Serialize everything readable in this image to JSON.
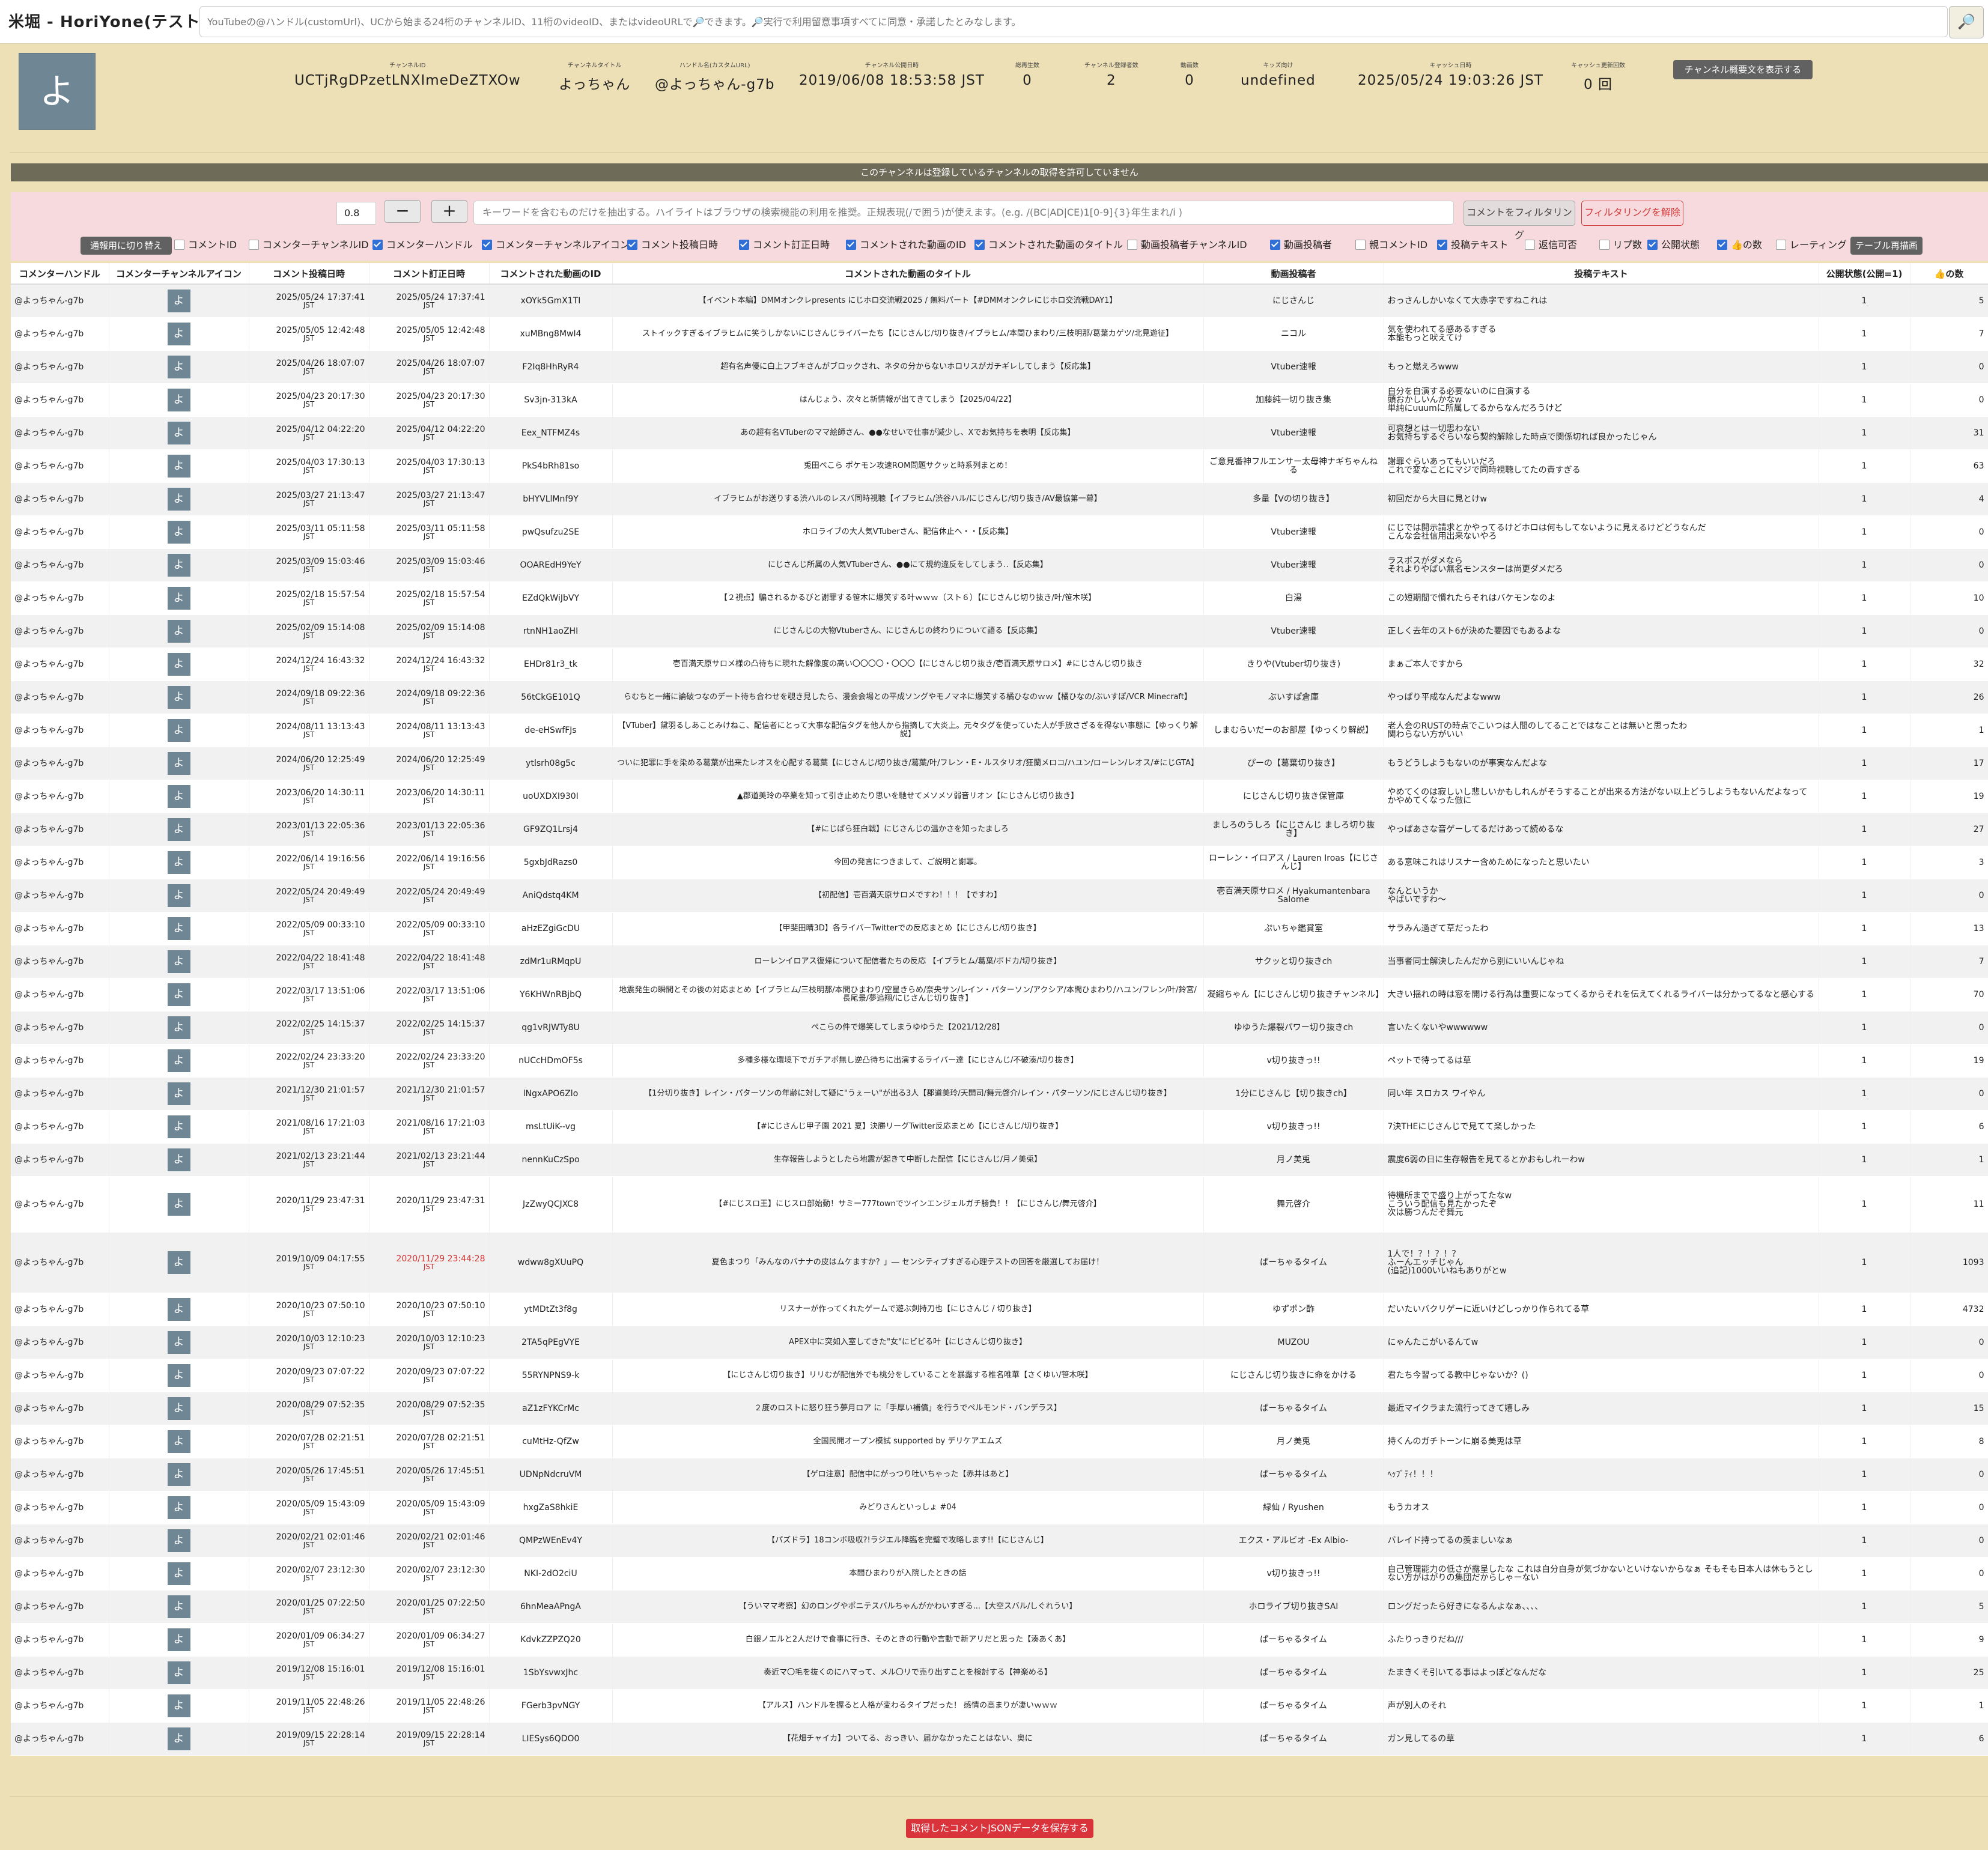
{
  "app_title": "米堀 - HoriYone(テスト中)",
  "search": {
    "placeholder": "YouTubeの@ハンドル(customUrl)、UCから始まる24桁のチャンネルID、11桁のvideoID、またはvideoURLで🔎できます。🔎実行で利用留意事項すべてに同意・承諾したとみなします。",
    "button_icon": "🔎"
  },
  "channel": {
    "avatar_char": "よ",
    "fields": [
      {
        "label": "チャンネルID",
        "value": "UCTjRgDPzetLNXImeDeZTXOw"
      },
      {
        "label": "チャンネルタイトル",
        "value": "よっちゃん"
      },
      {
        "label": "ハンドル名(カスタムURL)",
        "value": "@よっちゃん-g7b"
      },
      {
        "label": "チャンネル公開日時",
        "value": "2019/06/08 18:53:58 JST"
      },
      {
        "label": "総再生数",
        "value": "0"
      },
      {
        "label": "チャンネル登録者数",
        "value": "2"
      },
      {
        "label": "動画数",
        "value": "0"
      },
      {
        "label": "キッズ向け",
        "value": "undefined"
      },
      {
        "label": "キャッシュ日時",
        "value": "2025/05/24 19:03:26 JST"
      },
      {
        "label": "キャッシュ更新回数",
        "value": "0 回"
      }
    ],
    "show_desc_label": "チャンネル概要文を表示する"
  },
  "notice": "このチャンネルは登録しているチャンネルの取得を許可していません",
  "filter": {
    "threshold": "0.8",
    "minus": "−",
    "plus": "+",
    "keyword_placeholder": "キーワードを含むものだけを抽出する。ハイライトはブラウザの検索機能の利用を推奨。正規表現(/で囲う)が使えます。(e.g. /(BC|AD|CE)1[0-9]{3}年生まれ/i )",
    "filter_button": "コメントをフィルタリング",
    "clear_button": "フィルタリングを解除",
    "switch_button": "通報用に切り替え",
    "redraw_button": "テーブル再描画",
    "checkboxes": [
      {
        "label": "コメントID",
        "checked": false
      },
      {
        "label": "コメンターチャンネルID",
        "checked": false
      },
      {
        "label": "コメンターハンドル",
        "checked": true
      },
      {
        "label": "コメンターチャンネルアイコン",
        "checked": true
      },
      {
        "label": "コメント投稿日時",
        "checked": true
      },
      {
        "label": "コメント訂正日時",
        "checked": true
      },
      {
        "label": "コメントされた動画のID",
        "checked": true
      },
      {
        "label": "コメントされた動画のタイトル",
        "checked": true
      },
      {
        "label": "動画投稿者チャンネルID",
        "checked": false
      },
      {
        "label": "動画投稿者",
        "checked": true
      },
      {
        "label": "親コメントID",
        "checked": false
      },
      {
        "label": "投稿テキスト",
        "checked": true
      },
      {
        "label": "返信可否",
        "checked": false
      },
      {
        "label": "リプ数",
        "checked": false
      },
      {
        "label": "公開状態",
        "checked": true
      },
      {
        "label": "👍の数",
        "checked": true
      },
      {
        "label": "レーティング",
        "checked": false
      }
    ]
  },
  "table": {
    "headers": [
      "コメンターハンドル",
      "コメンターチャンネルアイコン",
      "コメント投稿日時",
      "コメント訂正日時",
      "コメントされた動画のID",
      "コメントされた動画のタイトル",
      "動画投稿者",
      "投稿テキスト",
      "公開状態(公開=1)",
      "👍の数"
    ],
    "rows": [
      [
        "@よっちゃん-g7b",
        "よ",
        "2025/05/24 17:37:41",
        "2025/05/24 17:37:41",
        "xOYk5GmX1TI",
        "【イベント本編】DMMオンクレpresents にじホロ交流戦2025 / 無料パート【#DMMオンクレにじホロ交流戦DAY1】",
        "にじさんじ",
        "おっさんしかいなくて大赤字ですねこれは",
        "1",
        "5"
      ],
      [
        "@よっちゃん-g7b",
        "よ",
        "2025/05/05 12:42:48",
        "2025/05/05 12:42:48",
        "xuMBng8MwI4",
        "ストイックすぎるイブラヒムに笑うしかないにじさんじライバーたち【にじさんじ/切り抜き/イブラヒム/本間ひまわり/三枝明那/葛葉カゲツ/北見遊征】",
        "ニコル",
        "気を使われてる感あるすぎる\n本能もっと吠えてけ",
        "1",
        "7"
      ],
      [
        "@よっちゃん-g7b",
        "よ",
        "2025/04/26 18:07:07",
        "2025/04/26 18:07:07",
        "F2Iq8HhRyR4",
        "超有名声優に白上フブキさんがブロックされ、ネタの分からないホロリスがガチギレしてしまう【反応集】",
        "Vtuber速報",
        "もっと燃えろwww",
        "1",
        "0"
      ],
      [
        "@よっちゃん-g7b",
        "よ",
        "2025/04/23 20:17:30",
        "2025/04/23 20:17:30",
        "Sv3jn-313kA",
        "はんじょう、次々と新情報が出てきてしまう【2025/04/22】",
        "加藤純一切り抜き集",
        "自分を自演する必要ないのに自演する\n頭おかしいんかなw\n単純にuuumに所属してるからなんだろうけど",
        "1",
        "0"
      ],
      [
        "@よっちゃん-g7b",
        "よ",
        "2025/04/12 04:22:20",
        "2025/04/12 04:22:20",
        "Eex_NTFMZ4s",
        "あの超有名VTuberのママ絵師さん、●●なせいで仕事が減少し、Xでお気持ちを表明【反応集】",
        "Vtuber速報",
        "可哀想とは一切思わない\nお気持ちするぐらいなら契約解除した時点で関係切れば良かったじゃん",
        "1",
        "31"
      ],
      [
        "@よっちゃん-g7b",
        "よ",
        "2025/04/03 17:30:13",
        "2025/04/03 17:30:13",
        "PkS4bRh81so",
        "兎田ぺこら ポケモン攻速ROM問題サクッと時系列まとめ！",
        "ご意見番神フルエンサー太母神ナギちゃんねる",
        "謝罪ぐらいあってもいいだろ\nこれで変なことにマジで同時視聴してたの責すぎる",
        "1",
        "63"
      ],
      [
        "@よっちゃん-g7b",
        "よ",
        "2025/03/27 21:13:47",
        "2025/03/27 21:13:47",
        "bHYVLlMnf9Y",
        "イブラヒムがお送りする渋ハルのレスバ同時視聴【イブラヒム/渋谷ハル/にじさんじ/切り抜き/AV最協第一幕】",
        "多量【Vの切り抜き】",
        "初回だから大目に見とけw",
        "1",
        "4"
      ],
      [
        "@よっちゃん-g7b",
        "よ",
        "2025/03/11 05:11:58",
        "2025/03/11 05:11:58",
        "pwQsufzu2SE",
        "ホロライブの大人気VTuberさん、配信休止へ・・【反応集】",
        "Vtuber速報",
        "にじでは開示請求とかやってるけどホロは何もしてないように見えるけどどうなんだ\nこんな会社信用出来ないやろ",
        "1",
        "0"
      ],
      [
        "@よっちゃん-g7b",
        "よ",
        "2025/03/09 15:03:46",
        "2025/03/09 15:03:46",
        "OOAREdH9YeY",
        "にじさんじ所属の人気VTuberさん、●●にて規約違反をしてしまう‥【反応集】",
        "Vtuber速報",
        "ラスボスがダメなら\nそれよりやばい無名モンスターは尚更ダメだろ",
        "1",
        "0"
      ],
      [
        "@よっちゃん-g7b",
        "よ",
        "2025/02/18 15:57:54",
        "2025/02/18 15:57:54",
        "EZdQkWiJbVY",
        "【２視点】騙されるかるびと謝罪する笹木に爆笑する叶ｗｗｗ（スト６）【にじさんじ切り抜き/叶/笹木咲】",
        "白湯",
        "この短期間で慣れたらそれはバケモンなのよ",
        "1",
        "10"
      ],
      [
        "@よっちゃん-g7b",
        "よ",
        "2025/02/09 15:14:08",
        "2025/02/09 15:14:08",
        "rtnNH1aoZHI",
        "にじさんじの大物Vtuberさん、にじさんじの終わりについて語る【反応集】",
        "Vtuber速報",
        "正しく去年のスト6が決めた要因でもあるよな",
        "1",
        "0"
      ],
      [
        "@よっちゃん-g7b",
        "よ",
        "2024/12/24 16:43:32",
        "2024/12/24 16:43:32",
        "EHDr81r3_tk",
        "壱百満天原サロメ様の凸待ちに現れた解像度の高い〇〇〇〇・〇〇〇【にじさんじ切り抜き/壱百満天原サロメ】#にじさんじ切り抜き",
        "きりや(Vtuber切り抜き)",
        "まぁご本人ですから",
        "1",
        "32"
      ],
      [
        "@よっちゃん-g7b",
        "よ",
        "2024/09/18 09:22:36",
        "2024/09/18 09:22:36",
        "56tCkGE101Q",
        "らむちと一緒に論破つなのデート待ち合わせを覗き見したら、漫会会場との平成ソングやモノマネに爆笑する橘ひなのｗｗ【橘ひなの/ぶいすぽ/VCR Minecraft】",
        "ぶいすぽ倉庫",
        "やっぱり平成なんだよなwww",
        "1",
        "26"
      ],
      [
        "@よっちゃん-g7b",
        "よ",
        "2024/08/11 13:13:43",
        "2024/08/11 13:13:43",
        "de-eHSwfFJs",
        "【VTuber】黛羽るしあことみけねこ、配信者にとって大事な配信タグを他人から指摘して大炎上。元々タグを使っていた人が手放さざるを得ない事態に【ゆっくり解説】",
        "しまむらいだーのお部屋【ゆっくり解説】",
        "老人会のRUSTの時点でこいつは人間のしてることではなことは無いと思ったわ\n関わらない方がいい",
        "1",
        "1"
      ],
      [
        "@よっちゃん-g7b",
        "よ",
        "2024/06/20 12:25:49",
        "2024/06/20 12:25:49",
        "ytlsrh08g5c",
        "ついに犯罪に手を染める葛葉が出来たレオスを心配する葛葉【にじさんじ/切り抜き/葛葉/叶/フレン・E・ルスタリオ/狂蘭メロコ/ハユン/ローレン/レオス/#にじGTA】",
        "ぴーの【葛葉切り抜き】",
        "もうどうしようもないのが事実なんだよな",
        "1",
        "17"
      ],
      [
        "@よっちゃん-g7b",
        "よ",
        "2023/06/20 14:30:11",
        "2023/06/20 14:30:11",
        "uoUXDXI930I",
        "▲郡道美玲の卒業を知って引き止めたり思いを馳せてメソメソ弱音リオン【にじさんじ切り抜き】",
        "にじさんじ切り抜き保管庫",
        "やめてくのは寂しいし悲しいかもしれんがそうすることが出来る方法がない以上どうしようもないんだよなってかやめてくなった倣に",
        "1",
        "19"
      ],
      [
        "@よっちゃん-g7b",
        "よ",
        "2023/01/13 22:05:36",
        "2023/01/13 22:05:36",
        "GF9ZQ1Lrsj4",
        "【#にじぱら狂白戦】にじさんじの温かさを知ったましろ",
        "ましろのうしろ【にじさんじ ましろ切り抜き】",
        "やっぱあさな音ゲーしてるだけあって読めるな",
        "1",
        "27"
      ],
      [
        "@よっちゃん-g7b",
        "よ",
        "2022/06/14 19:16:56",
        "2022/06/14 19:16:56",
        "5gxbJdRazs0",
        "今回の発言につきまして、ご説明と謝罪。",
        "ローレン・イロアス / Lauren Iroas【にじさんじ】",
        "ある意味これはリスナー含めためになったと思いたい",
        "1",
        "3"
      ],
      [
        "@よっちゃん-g7b",
        "よ",
        "2022/05/24 20:49:49",
        "2022/05/24 20:49:49",
        "AniQdstq4KM",
        "【初配信】壱百満天原サロメですわ！！！【ですわ】",
        "壱百満天原サロメ / Hyakumantenbara Salome",
        "なんというか\nやばいですわ～",
        "1",
        "0"
      ],
      [
        "@よっちゃん-g7b",
        "よ",
        "2022/05/09 00:33:10",
        "2022/05/09 00:33:10",
        "aHzEZgiGcDU",
        "【甲斐田晴3D】各ライバーTwitterでの反応まとめ【にじさんじ/切り抜き】",
        "ぷいちゃ鑑賞室",
        "サラみん過ぎて草だったわ",
        "1",
        "13"
      ],
      [
        "@よっちゃん-g7b",
        "よ",
        "2022/04/22 18:41:48",
        "2022/04/22 18:41:48",
        "zdMr1uRMqpU",
        "ローレンイロアス復帰について配信者たちの反応 【イブラヒム/葛葉/ボドカ/切り抜き】",
        "サクッと切り抜きch",
        "当事者同士解決したんだから別にいいんじゃね",
        "1",
        "7"
      ],
      [
        "@よっちゃん-g7b",
        "よ",
        "2022/03/17 13:51:06",
        "2022/03/17 13:51:06",
        "Y6KHWnRBjbQ",
        "地震発生の瞬間とその後の対応まとめ【イブラヒム/三枝明那/本間ひまわり/空星きらめ/奈央サン/レイン・パターソン/アクシア/本間ひまわり/ハユン/フレン/叶/鈴宮/長尾景/夢追翔/にじさんじ切り抜き】",
        "凝縮ちゃん【にじさんじ切り抜きチャンネル】",
        "大きい揺れの時は窓を開ける行為は重要になってくるからそれを伝えてくれるライバーは分かってるなと感心する",
        "1",
        "70"
      ],
      [
        "@よっちゃん-g7b",
        "よ",
        "2022/02/25 14:15:37",
        "2022/02/25 14:15:37",
        "qg1vRJWTy8U",
        "ぺこらの件で爆笑してしまうゆゆうた【2021/12/28】",
        "ゆゆうた爆裂パワー切り抜きch",
        "言いたくないやwwwwww",
        "1",
        "0"
      ],
      [
        "@よっちゃん-g7b",
        "よ",
        "2022/02/24 23:33:20",
        "2022/02/24 23:33:20",
        "nUCcHDmOF5s",
        "多種多様な環境下でガチアポ無し逆凸待ちに出演するライバー達【にじさんじ/不破湊/切り抜き】",
        "v切り抜きっ!!",
        "ペットで待ってるは草",
        "1",
        "19"
      ],
      [
        "@よっちゃん-g7b",
        "よ",
        "2021/12/30 21:01:57",
        "2021/12/30 21:01:57",
        "lNgxAPO6Zlo",
        "【1分切り抜き】レイン・パターソンの年齢に対して疑に\"うぇーい\"が出る3人【郡道美玲/天開司/舞元啓介/レイン・パターソン/にじさんじ切り抜き】",
        "1分にじさんじ【切り抜きch】",
        "同い年 スロカス ワイやん",
        "1",
        "0"
      ],
      [
        "@よっちゃん-g7b",
        "よ",
        "2021/08/16 17:21:03",
        "2021/08/16 17:21:03",
        "msLtUiK--vg",
        "【#にじさんじ甲子園 2021 夏】決勝リーグTwitter反応まとめ【にじさんじ/切り抜き】",
        "v切り抜きっ!!",
        "7決THEにじさんじで見てて楽しかった",
        "1",
        "6"
      ],
      [
        "@よっちゃん-g7b",
        "よ",
        "2021/02/13 23:21:44",
        "2021/02/13 23:21:44",
        "nennKuCzSpo",
        "生存報告しようとしたら地震が起きて中断した配信【にじさんじ/月ノ美兎】",
        "月ノ美兎",
        "震度6弱の日に生存報告を見てるとかおもしれーわw",
        "1",
        "1"
      ],
      [
        "@よっちゃん-g7b",
        "よ",
        "2020/11/29 23:47:31",
        "2020/11/29 23:47:31",
        "JzZwyQCJXC8",
        "【#にじスロ王】にじスロ部始動！サミー777townでツインエンジェルガチ勝負！！【にじさんじ/舞元啓介】",
        "舞元啓介",
        "待機所までで盛り上がってたなw\nこういう配信も見たかったぞ\n次は勝つんだぞ舞元",
        "1",
        "11"
      ],
      [
        "@よっちゃん-g7b",
        "よ",
        "2019/10/09 04:17:55",
        "2020/11/29 23:44:28",
        "wdww8gXUuPQ",
        "夏色まつり「みんなのバナナの皮はムケますか？」― センシティブすぎる心理テストの回答を厳選してお届け！",
        "ぱーちゃるタイム",
        "1人で！？！？！？\nふーんエッチじゃん\n(追記)1000いいねもありがとw",
        "1",
        "1093"
      ],
      [
        "@よっちゃん-g7b",
        "よ",
        "2020/10/23 07:50:10",
        "2020/10/23 07:50:10",
        "ytMDtZt3f8g",
        "リスナーが作ってくれたゲームで遊ぶ剣持刀也【にじさんじ / 切り抜き】",
        "ゆずポン酢",
        "だいたいバクリゲーに近いけどしっかり作られてる草",
        "1",
        "4732"
      ],
      [
        "@よっちゃん-g7b",
        "よ",
        "2020/10/03 12:10:23",
        "2020/10/03 12:10:23",
        "2TA5qPEgVYE",
        "APEX中に突如入室してきた\"女\"にビビる叶【にじさんじ切り抜き】",
        "MUZOU",
        "にゃんたこがいるんてw",
        "1",
        "0"
      ],
      [
        "@よっちゃん-g7b",
        "よ",
        "2020/09/23 07:07:22",
        "2020/09/23 07:07:22",
        "55RYNPNS9-k",
        "【にじさんじ切り抜き】リリむが配信外でも桃分をしていることを暴露する椎名唯華【さくゆい/笹木咲】",
        "にじさんじ切り抜きに命をかける",
        "君たち今習ってる教中じゃないか？()",
        "1",
        "0"
      ],
      [
        "@よっちゃん-g7b",
        "よ",
        "2020/08/29 07:52:35",
        "2020/08/29 07:52:35",
        "aZ1zFYKCrMc",
        "２度のロストに怒り狂う夢月ロア に「手厚い補償」を行うでペルモンド・バンデラス】",
        "ぱーちゃるタイム",
        "最近マイクラまた流行ってきて嬉しみ",
        "1",
        "15"
      ],
      [
        "@よっちゃん-g7b",
        "よ",
        "2020/07/28 02:21:51",
        "2020/07/28 02:21:51",
        "cuMtHz-QfZw",
        "全国民開オープン模試 supported by デリケアエムズ",
        "月ノ美兎",
        "持くんのガチトーンに崩る美兎は草",
        "1",
        "8"
      ],
      [
        "@よっちゃん-g7b",
        "よ",
        "2020/05/26 17:45:51",
        "2020/05/26 17:45:51",
        "UDNpNdcruVM",
        "【ゲロ注意】配信中にがっつり吐いちゃった【赤井はあと】",
        "ぱーちゃるタイム",
        "ﾍｯﾌﾞﾃｨ！！！",
        "1",
        "0"
      ],
      [
        "@よっちゃん-g7b",
        "よ",
        "2020/05/09 15:43:09",
        "2020/05/09 15:43:09",
        "hxgZaS8hkiE",
        "みどりさんといっしょ #04",
        "緑仙 / Ryushen",
        "もうカオス",
        "1",
        "0"
      ],
      [
        "@よっちゃん-g7b",
        "よ",
        "2020/02/21 02:01:46",
        "2020/02/21 02:01:46",
        "QMPzWEnEv4Y",
        "【パズドラ】18コンボ吸収?!ラジエル降臨を完璧で攻略します!!【にじさんじ】",
        "エクス・アルビオ -Ex Albio-",
        "バレイド持ってるの羨ましいなぁ",
        "1",
        "0"
      ],
      [
        "@よっちゃん-g7b",
        "よ",
        "2020/02/07 23:12:30",
        "2020/02/07 23:12:30",
        "NKI-2dO2ciU",
        "本間ひまわりが入院したときの話",
        "v切り抜きっ!!",
        "自己管理能力の低さが露呈したな これは自分自身が気づかないといけないからなぁ そもそも日本人は休もうとしない方がはがりの集団だからしゃーない",
        "1",
        "0"
      ],
      [
        "@よっちゃん-g7b",
        "よ",
        "2020/01/25 07:22:50",
        "2020/01/25 07:22:50",
        "6hnMeaAPngA",
        "【ういママ考察】幻のロングやポニテスバルちゃんがかわいすぎる...【大空スバル/しぐれうい】",
        "ホロライブ切り抜きSAI",
        "ロングだったら好きになるんよなぁ、、、、",
        "1",
        "5"
      ],
      [
        "@よっちゃん-g7b",
        "よ",
        "2020/01/09 06:34:27",
        "2020/01/09 06:34:27",
        "KdvkZZPZQ20",
        "白銀ノエルと2人だけで食事に行き、そのときの行動や言動で新アリだと思った【湊あくあ】",
        "ぱーちゃるタイム",
        "ふたりっきりだね///",
        "1",
        "9"
      ],
      [
        "@よっちゃん-g7b",
        "よ",
        "2019/12/08 15:16:01",
        "2019/12/08 15:16:01",
        "1SbYsvwxJhc",
        "奏近マ〇毛を抜くのにハマって、メル〇リで売り出すことを検討する【神楽める】",
        "ぱーちゃるタイム",
        "たまきくそ引いてる事はよっぽどなんだな",
        "1",
        "25"
      ],
      [
        "@よっちゃん-g7b",
        "よ",
        "2019/11/05 22:48:26",
        "2019/11/05 22:48:26",
        "FGerb3pvNGY",
        "【アルス】ハンドルを握ると人格が変わるタイプだった！ 感情の高まりが凄いｗｗｗ",
        "ぱーちゃるタイム",
        "声が別人のそれ",
        "1",
        "1"
      ],
      [
        "@よっちゃん-g7b",
        "よ",
        "2019/09/15 22:28:14",
        "2019/09/15 22:28:14",
        "LIESys6QDO0",
        "【花畑チャイカ】ついてる、おっきい、届かなかったことはない、奥に",
        "ぱーちゃるタイム",
        "ガン見してるの草",
        "1",
        "6"
      ]
    ],
    "date_suffix": "JST",
    "highlight_color": "#d33333"
  },
  "footer": {
    "save_button": "取得したコメントJSONデータを保存する"
  }
}
